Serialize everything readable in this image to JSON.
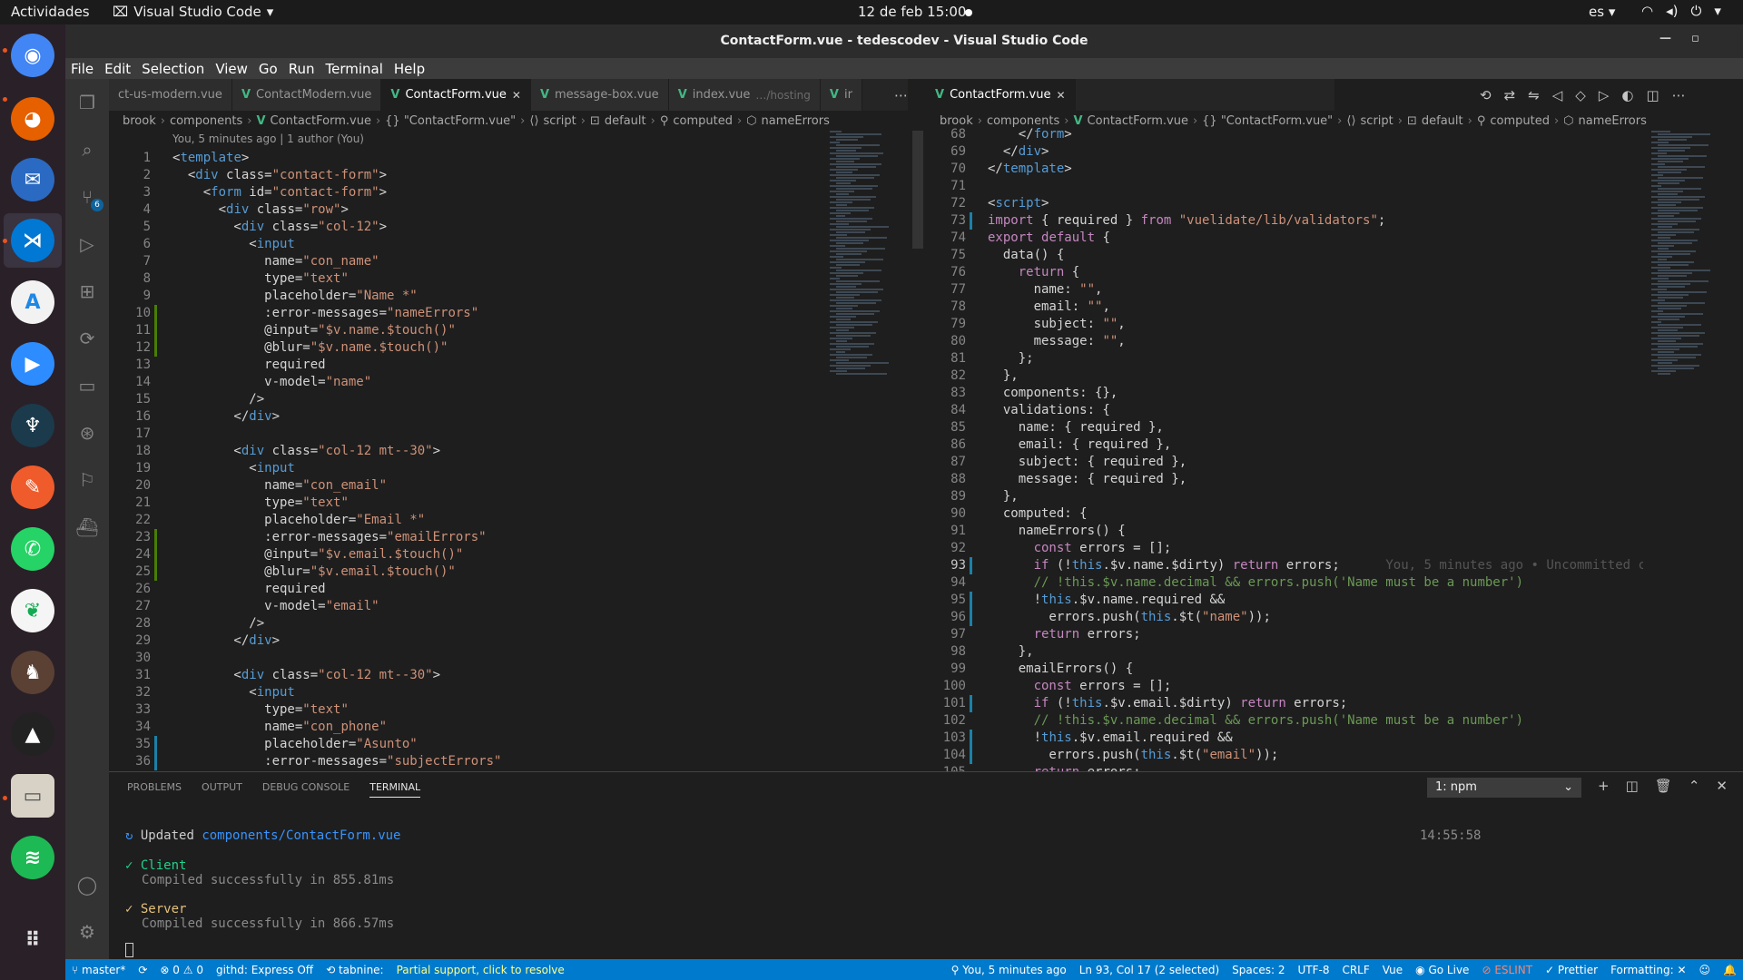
{
  "gnome": {
    "activities": "Actividades",
    "app": "Visual Studio Code",
    "clock": "12 de feb  15:00",
    "lang": "es"
  },
  "window": {
    "title": "ContactForm.vue - tedescodev - Visual Studio Code"
  },
  "menu": [
    "File",
    "Edit",
    "Selection",
    "View",
    "Go",
    "Run",
    "Terminal",
    "Help"
  ],
  "left_tabs": [
    {
      "label": "ct-us-modern.vue",
      "hint": "",
      "active": false,
      "vue": false
    },
    {
      "label": "ContactModern.vue",
      "hint": "",
      "active": false,
      "vue": true
    },
    {
      "label": "ContactForm.vue",
      "hint": "",
      "active": true,
      "vue": true
    },
    {
      "label": "message-box.vue",
      "hint": "",
      "active": false,
      "vue": true
    },
    {
      "label": "index.vue",
      "hint": "…/hosting",
      "active": false,
      "vue": true
    },
    {
      "label": "ir",
      "hint": "",
      "active": false,
      "vue": true
    }
  ],
  "right_tabs": [
    {
      "label": "ContactForm.vue",
      "active": true
    }
  ],
  "left_crumbs": [
    "brook",
    "components",
    "ContactForm.vue",
    "{} \"ContactForm.vue\"",
    "script",
    "default",
    "computed",
    "nameErrors"
  ],
  "right_crumbs": [
    "brook",
    "components",
    "ContactForm.vue",
    "{} \"ContactForm.vue\"",
    "script",
    "default",
    "computed",
    "nameErrors"
  ],
  "blame": "You, 5 minutes ago | 1 author (You)",
  "left_start_line": 1,
  "left_lines": [
    "<template>",
    "  <div class=\"contact-form\">",
    "    <form id=\"contact-form\">",
    "      <div class=\"row\">",
    "        <div class=\"col-12\">",
    "          <input",
    "            name=\"con_name\"",
    "            type=\"text\"",
    "            placeholder=\"Name *\"",
    "            :error-messages=\"nameErrors\"",
    "            @input=\"$v.name.$touch()\"",
    "            @blur=\"$v.name.$touch()\"",
    "            required",
    "            v-model=\"name\"",
    "          />",
    "        </div>",
    "",
    "        <div class=\"col-12 mt--30\">",
    "          <input",
    "            name=\"con_email\"",
    "            type=\"text\"",
    "            placeholder=\"Email *\"",
    "            :error-messages=\"emailErrors\"",
    "            @input=\"$v.email.$touch()\"",
    "            @blur=\"$v.email.$touch()\"",
    "            required",
    "            v-model=\"email\"",
    "          />",
    "        </div>",
    "",
    "        <div class=\"col-12 mt--30\">",
    "          <input",
    "            type=\"text\"",
    "            name=\"con_phone\"",
    "            placeholder=\"Asunto\"",
    "            :error-messages=\"subjectErrors\""
  ],
  "right_start_line": 68,
  "right_lines": [
    "    </form>",
    "  </div>",
    "</template>",
    "",
    "<script>",
    "import { required } from \"vuelidate/lib/validators\";",
    "export default {",
    "  data() {",
    "    return {",
    "      name: \"\",",
    "      email: \"\",",
    "      subject: \"\",",
    "      message: \"\",",
    "    };",
    "  },",
    "  components: {},",
    "  validations: {",
    "    name: { required },",
    "    email: { required },",
    "    subject: { required },",
    "    message: { required },",
    "  },",
    "  computed: {",
    "    nameErrors() {",
    "      const errors = [];",
    "      if (!this.$v.name.$dirty) return errors;",
    "      // !this.$v.name.decimal && errors.push('Name must be a number')",
    "      !this.$v.name.required &&",
    "        errors.push(this.$t(\"name\"));",
    "      return errors;",
    "    },",
    "    emailErrors() {",
    "      const errors = [];",
    "      if (!this.$v.email.$dirty) return errors;",
    "      // !this.$v.name.decimal && errors.push('Name must be a number')",
    "      !this.$v.email.required &&",
    "        errors.push(this.$t(\"email\"));",
    "      return errors;"
  ],
  "current_line": 93,
  "inline_blame": "You, 5 minutes ago • Uncommitted c",
  "panel": {
    "tabs": [
      "PROBLEMS",
      "OUTPUT",
      "DEBUG CONSOLE",
      "TERMINAL"
    ],
    "active_tab": "TERMINAL",
    "terminal_select": "1: npm",
    "updated_prefix": "Updated",
    "updated_file": "components/ContactForm.vue",
    "updated_time": "14:55:58",
    "client_label": "Client",
    "client_msg": "Compiled successfully in 855.81ms",
    "server_label": "Server",
    "server_msg": "Compiled successfully in 866.57ms"
  },
  "status": {
    "branch": "master*",
    "errors": "0",
    "warnings": "0",
    "githd": "githd: Express Off",
    "tabnine": "tabnine:",
    "tabnine_msg": "Partial support, click to resolve",
    "blame": "You, 5 minutes ago",
    "position": "Ln 93, Col 17 (2 selected)",
    "spaces": "Spaces: 2",
    "encoding": "UTF-8",
    "eol": "CRLF",
    "lang": "Vue",
    "golive": "Go Live",
    "eslint": "ESLINT",
    "prettier": "Prettier",
    "formatting": "Formatting: ✕"
  },
  "colors": {
    "accent": "#007acc",
    "vue": "#41b883",
    "ubuntu": "#e95420"
  }
}
